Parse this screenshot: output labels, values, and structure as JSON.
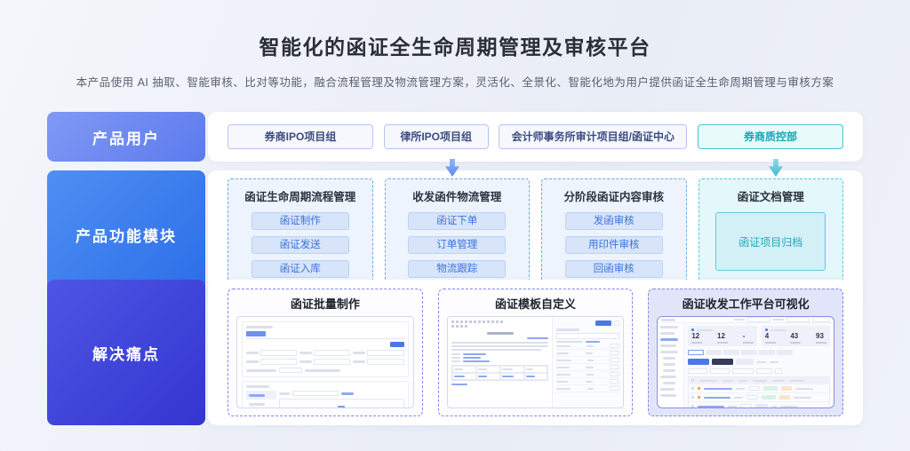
{
  "page": {
    "title": "智能化的函证全生命周期管理及审核平台",
    "subtitle": "本产品使用 AI 抽取、智能审核、比对等功能，融合流程管理及物流管理方案，灵活化、全景化、智能化地为用户提供函证全生命周期管理与审核方案"
  },
  "colors": {
    "accent_blue": "#2b6de8",
    "accent_periwinkle": "#6f8cf2",
    "accent_indigo": "#3f46dc",
    "accent_teal": "#2ab5c6",
    "module_button_bg": "#d7e4f9",
    "page_bg": "#edf0f8"
  },
  "rows": {
    "users": {
      "label": "产品用户",
      "items": [
        {
          "label": "券商IPO项目组",
          "variant": "blue"
        },
        {
          "label": "律所IPO项目组",
          "variant": "blue"
        },
        {
          "label": "会计师事务所审计项目组/函证中心",
          "variant": "blue"
        },
        {
          "label": "券商质控部",
          "variant": "teal"
        }
      ]
    },
    "modules": {
      "label": "产品功能模块",
      "groups": [
        {
          "title": "函证生命周期流程管理",
          "variant": "blue",
          "items": [
            "函证制作",
            "函证发送",
            "函证入库"
          ]
        },
        {
          "title": "收发函件物流管理",
          "variant": "blue",
          "items": [
            "函证下单",
            "订单管理",
            "物流跟踪"
          ]
        },
        {
          "title": "分阶段函证内容审核",
          "variant": "blue",
          "items": [
            "发函审核",
            "用印件审核",
            "回函审核"
          ]
        },
        {
          "title": "函证文档管理",
          "variant": "teal",
          "items": [
            "函证项目归档"
          ]
        }
      ]
    },
    "pain_points": {
      "label": "解决痛点",
      "cards": [
        {
          "title": "函证批量制作",
          "variant": "plain",
          "mock": "form"
        },
        {
          "title": "函证模板自定义",
          "variant": "plain",
          "mock": "editor"
        },
        {
          "title": "函证收发工作平台可视化",
          "variant": "tinted",
          "mock": "dashboard"
        }
      ]
    }
  },
  "dashboard_stats": [
    "12",
    "12",
    "-",
    "4",
    "43",
    "93"
  ],
  "icons": {
    "flow_arrow_blue": "down-arrow",
    "flow_arrow_teal": "down-arrow"
  }
}
